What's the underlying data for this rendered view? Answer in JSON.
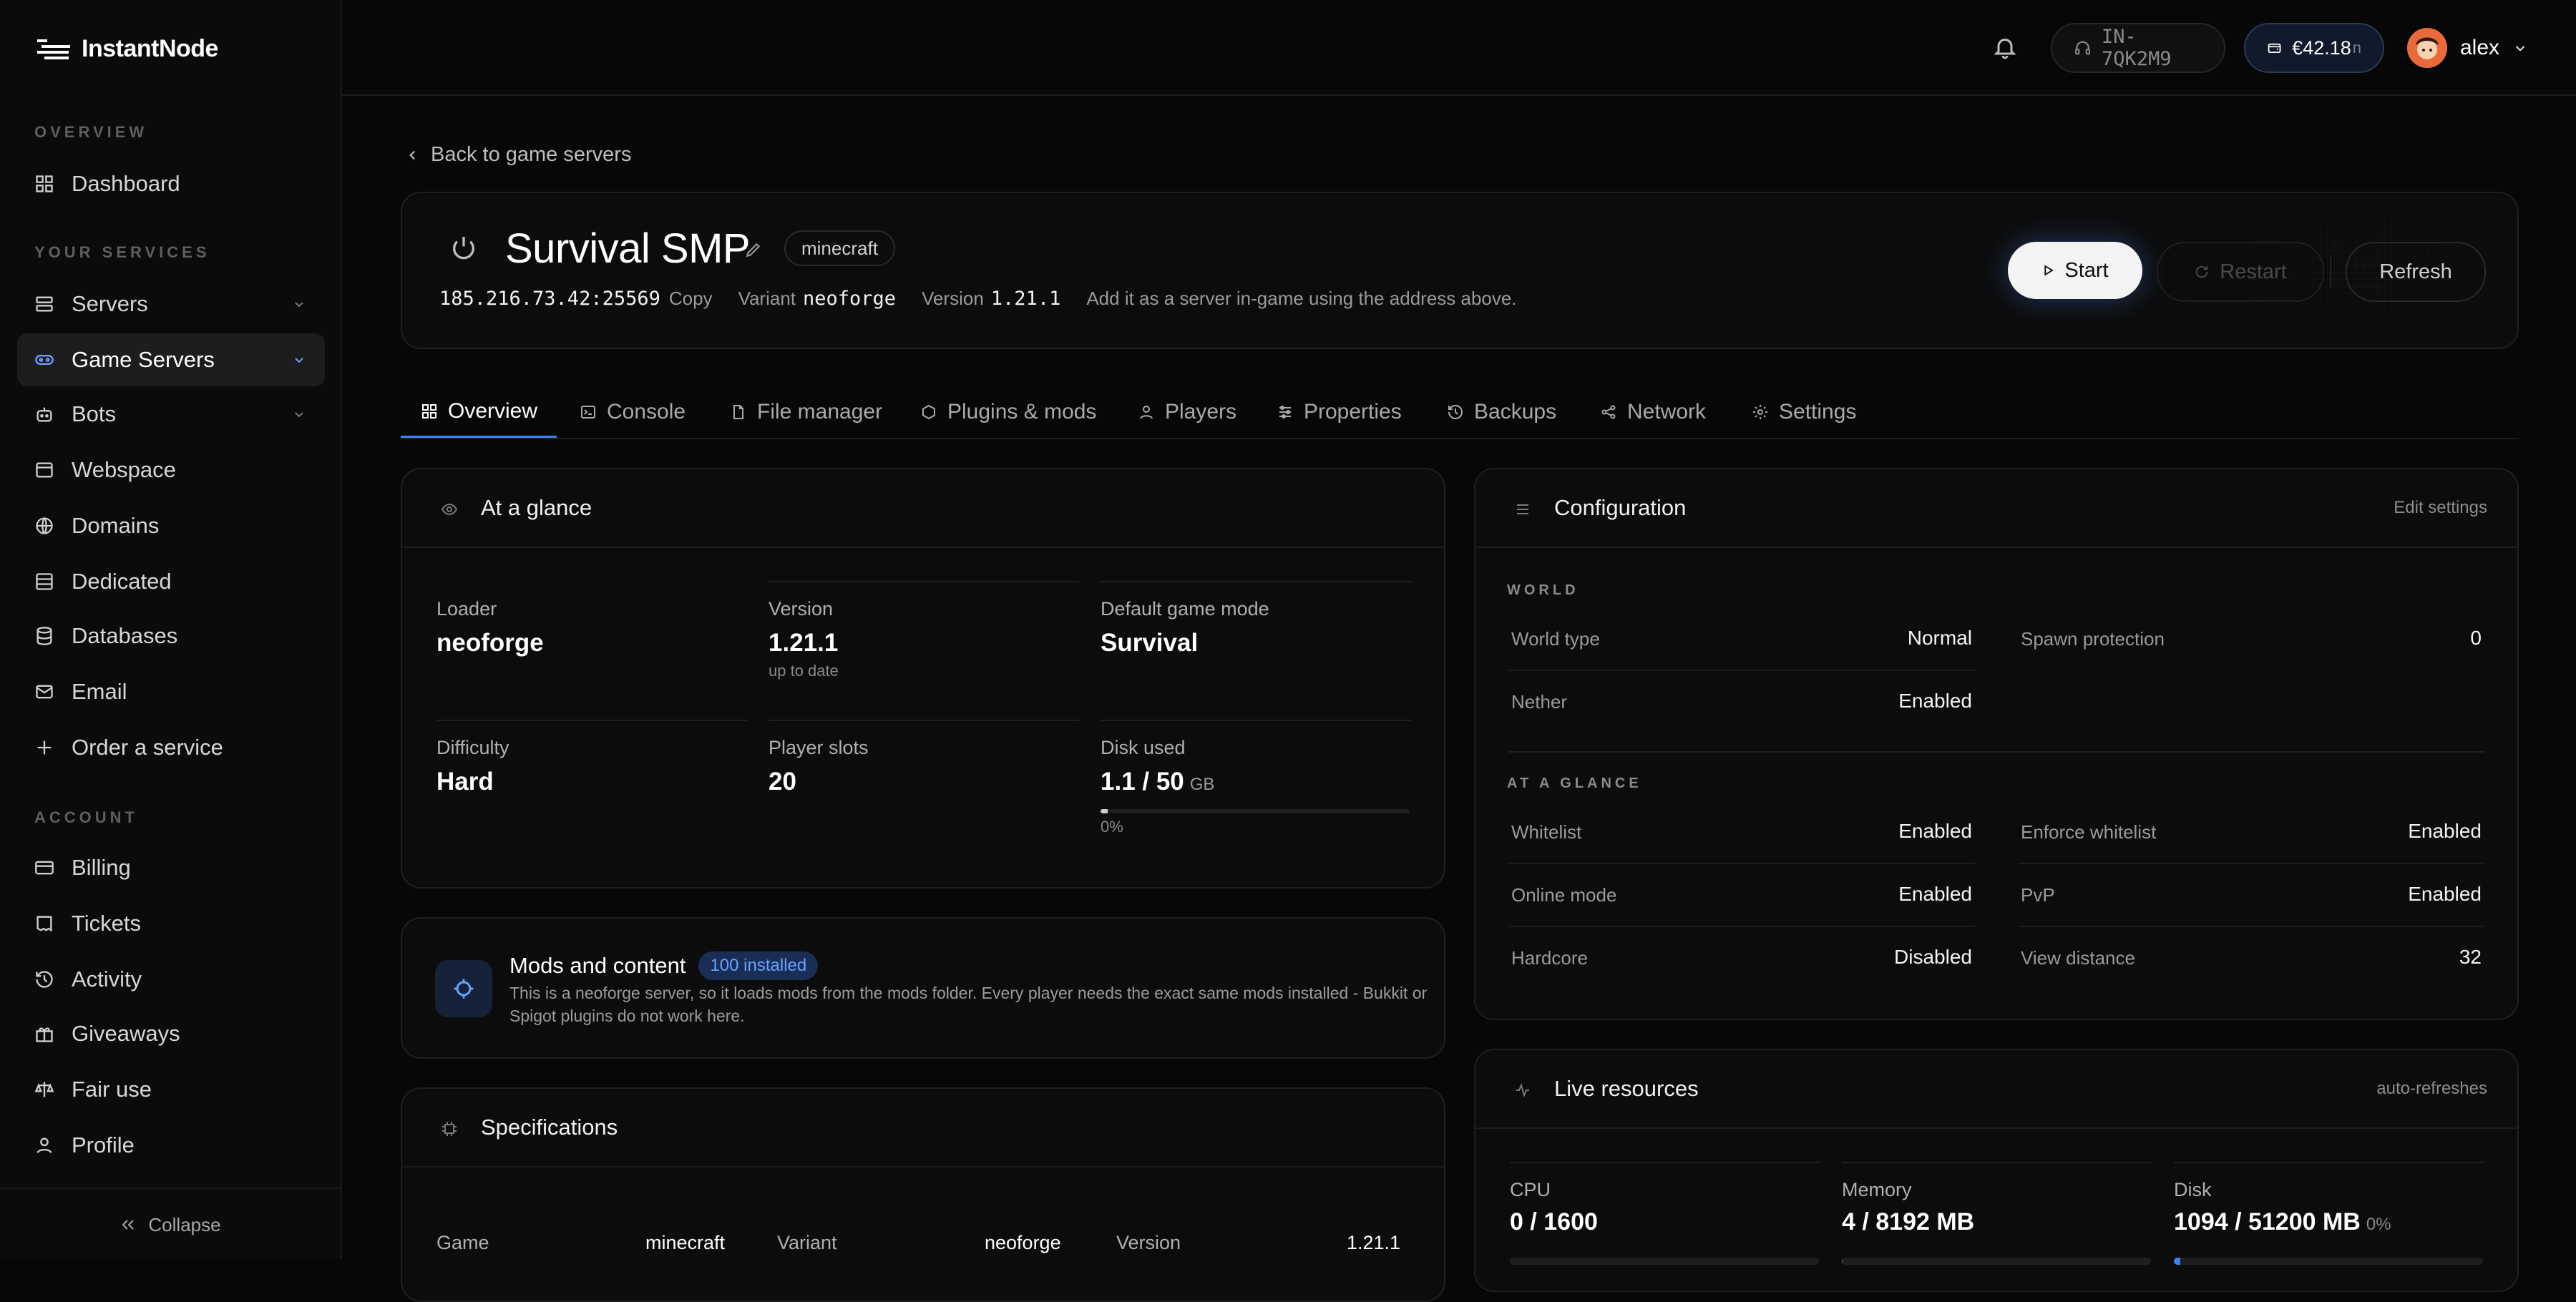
{
  "brand": {
    "name": "InstantNode"
  },
  "sidebar": {
    "sections": [
      "OVERVIEW",
      "YOUR SERVICES",
      "ACCOUNT"
    ],
    "items": [
      {
        "label": "Dashboard",
        "icon": "grid-icon"
      },
      {
        "label": "Servers",
        "icon": "server-icon",
        "expandable": true
      },
      {
        "label": "Game Servers",
        "icon": "gamepad-icon",
        "expandable": true,
        "active": true
      },
      {
        "label": "Bots",
        "icon": "bot-icon",
        "expandable": true
      },
      {
        "label": "Webspace",
        "icon": "globe-box-icon"
      },
      {
        "label": "Domains",
        "icon": "globe-icon"
      },
      {
        "label": "Dedicated",
        "icon": "dedicated-icon"
      },
      {
        "label": "Databases",
        "icon": "database-icon"
      },
      {
        "label": "Email",
        "icon": "mail-icon"
      },
      {
        "label": "Order a service",
        "icon": "plus-icon"
      },
      {
        "label": "Billing",
        "icon": "card-icon"
      },
      {
        "label": "Tickets",
        "icon": "ticket-icon"
      },
      {
        "label": "Activity",
        "icon": "history-icon"
      },
      {
        "label": "Giveaways",
        "icon": "gift-icon"
      },
      {
        "label": "Fair use",
        "icon": "scale-icon"
      },
      {
        "label": "Profile",
        "icon": "user-icon"
      }
    ],
    "collapse_label": "Collapse"
  },
  "topbar": {
    "ticket_id": "IN-7QK2M9",
    "balance": "€42.18",
    "balance_suffix": "n",
    "username": "alex"
  },
  "page": {
    "back_label": "Back to game servers",
    "server_name": "Survival SMP",
    "game_tag": "minecraft",
    "address": "185.216.73.42:25569",
    "copy_label": "Copy",
    "variant_label": "Variant",
    "variant_value": "neoforge",
    "version_label": "Version",
    "version_value": "1.21.1",
    "hint": "Add it as a server in-game using the address above.",
    "start_label": "Start",
    "restart_label": "Restart",
    "refresh_label": "Refresh"
  },
  "tabs": [
    {
      "label": "Overview",
      "active": true
    },
    {
      "label": "Console"
    },
    {
      "label": "File manager"
    },
    {
      "label": "Plugins & mods"
    },
    {
      "label": "Players"
    },
    {
      "label": "Properties"
    },
    {
      "label": "Backups"
    },
    {
      "label": "Network"
    },
    {
      "label": "Settings"
    }
  ],
  "glance": {
    "title": "At a glance",
    "loader_label": "Loader",
    "loader": "neoforge",
    "version_label": "Version",
    "version": "1.21.1",
    "version_sub": "up to date",
    "mode_label": "Default game mode",
    "mode": "Survival",
    "difficulty_label": "Difficulty",
    "difficulty": "Hard",
    "slots_label": "Player slots",
    "slots": "20",
    "disk_label": "Disk used",
    "disk": "1.1 / 50",
    "disk_unit": "GB",
    "disk_pct": "0%",
    "disk_fraction": 0.022
  },
  "mods": {
    "title": "Mods and content",
    "badge": "100 installed",
    "description": "This is a neoforge server, so it loads mods from the mods folder. Every player needs the exact same mods installed - Bukkit or Spigot plugins do not work here."
  },
  "specs": {
    "title": "Specifications",
    "game_label": "Game",
    "game": "minecraft",
    "variant_label": "Variant",
    "variant": "neoforge",
    "version_label": "Version",
    "version": "1.21.1"
  },
  "config": {
    "title": "Configuration",
    "edit_label": "Edit settings",
    "world_section": "WORLD",
    "world_type_label": "World type",
    "world_type": "Normal",
    "spawn_label": "Spawn protection",
    "spawn": "0",
    "nether_label": "Nether",
    "nether": "Enabled",
    "glance_section": "AT A GLANCE",
    "whitelist_label": "Whitelist",
    "whitelist": "Enabled",
    "enforce_label": "Enforce whitelist",
    "enforce": "Enabled",
    "online_label": "Online mode",
    "online": "Enabled",
    "pvp_label": "PvP",
    "pvp": "Enabled",
    "hardcore_label": "Hardcore",
    "hardcore": "Disabled",
    "view_label": "View distance",
    "view": "32"
  },
  "resources": {
    "title": "Live resources",
    "note": "auto-refreshes",
    "cpu_label": "CPU",
    "cpu": "0 / 1600",
    "cpu_fraction": 0,
    "mem_label": "Memory",
    "mem": "4 / 8192 MB",
    "mem_fraction": 0.0005,
    "disk_label": "Disk",
    "disk": "1094 / 51200 MB",
    "disk_pct": "0%",
    "disk_fraction": 0.021
  },
  "colors": {
    "accent": "#3b82f6",
    "background": "#070707",
    "card": "#0c0c0c"
  }
}
